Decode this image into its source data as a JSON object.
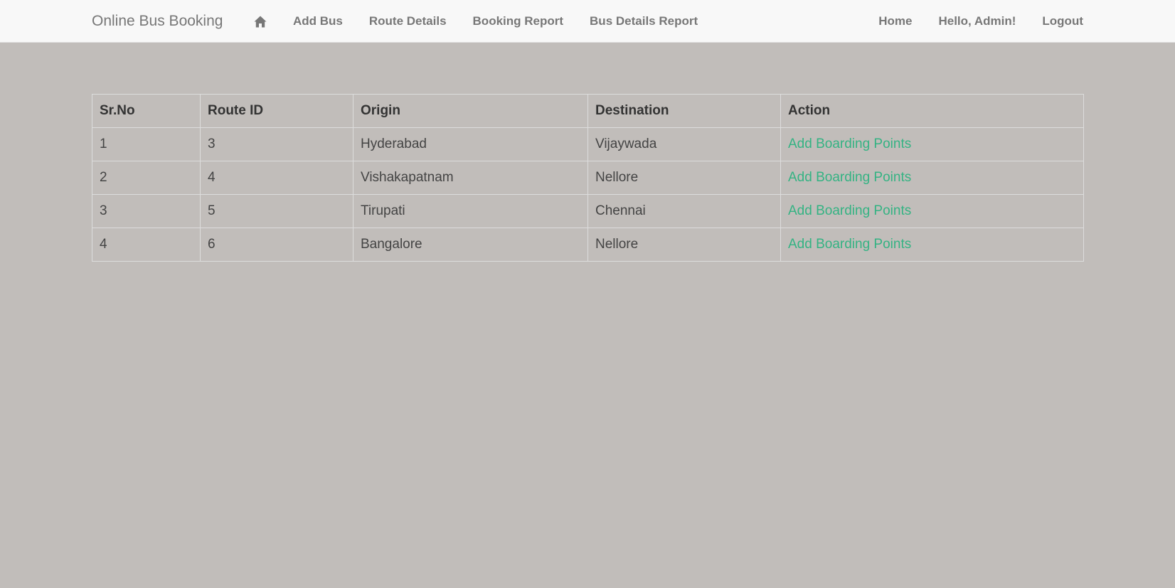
{
  "navbar": {
    "brand": "Online Bus Booking",
    "home_icon": "home-icon",
    "left_links": [
      {
        "label": "Add Bus"
      },
      {
        "label": "Route Details"
      },
      {
        "label": "Booking Report"
      },
      {
        "label": "Bus Details Report"
      }
    ],
    "right_links": [
      {
        "label": "Home"
      },
      {
        "label": "Hello, Admin!"
      },
      {
        "label": "Logout"
      }
    ]
  },
  "table": {
    "headers": [
      "Sr.No",
      "Route ID",
      "Origin",
      "Destination",
      "Action"
    ],
    "rows": [
      {
        "sr_no": "1",
        "route_id": "3",
        "origin": "Hyderabad",
        "destination": "Vijaywada",
        "action": "Add Boarding Points"
      },
      {
        "sr_no": "2",
        "route_id": "4",
        "origin": "Vishakapatnam",
        "destination": "Nellore",
        "action": "Add Boarding Points"
      },
      {
        "sr_no": "3",
        "route_id": "5",
        "origin": "Tirupati",
        "destination": "Chennai",
        "action": "Add Boarding Points"
      },
      {
        "sr_no": "4",
        "route_id": "6",
        "origin": "Bangalore",
        "destination": "Nellore",
        "action": "Add Boarding Points"
      }
    ]
  },
  "colors": {
    "background": "#c1bdba",
    "navbar": "#f8f8f8",
    "link_accent": "#34b383",
    "nav_text": "#777777"
  }
}
